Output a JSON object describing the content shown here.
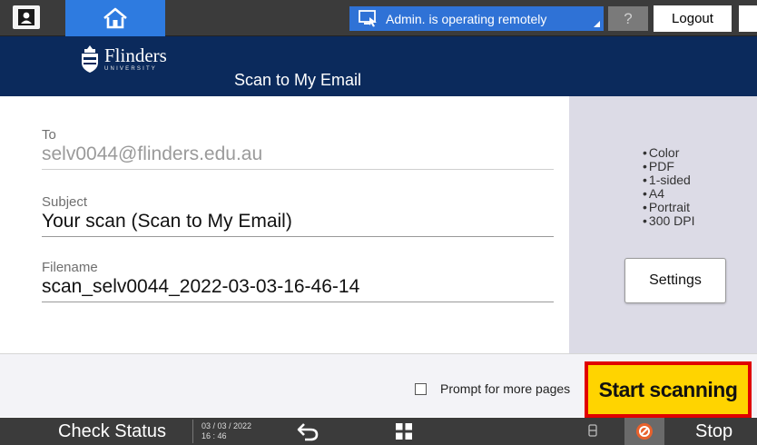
{
  "topbar": {
    "remote_status": "Admin. is operating remotely",
    "help_label": "?",
    "logout_label": "Logout"
  },
  "header": {
    "logo_name": "Flinders",
    "logo_sub": "UNIVERSITY",
    "app_title": "Scan to My Email"
  },
  "form": {
    "to": {
      "label": "To",
      "value": "selv0044@flinders.edu.au"
    },
    "subject": {
      "label": "Subject",
      "value": "Your scan (Scan to My Email)"
    },
    "filename": {
      "label": "Filename",
      "value": "scan_selv0044_2022-03-03-16-46-14"
    }
  },
  "settings": {
    "options": [
      "Color",
      "PDF",
      "1-sided",
      "A4",
      "Portrait",
      "300 DPI"
    ],
    "button_label": "Settings"
  },
  "actions": {
    "prompt_label": "Prompt for more pages",
    "prompt_checked": false,
    "start_label": "Start scanning"
  },
  "footer": {
    "check_status": "Check Status",
    "date": "03 / 03 / 2022",
    "time": "16 : 46",
    "stop_label": "Stop"
  },
  "colors": {
    "header_bg": "#0b2a5c",
    "accent_blue": "#2e7be0",
    "start_bg": "#ffd400",
    "start_border": "#e00000"
  }
}
